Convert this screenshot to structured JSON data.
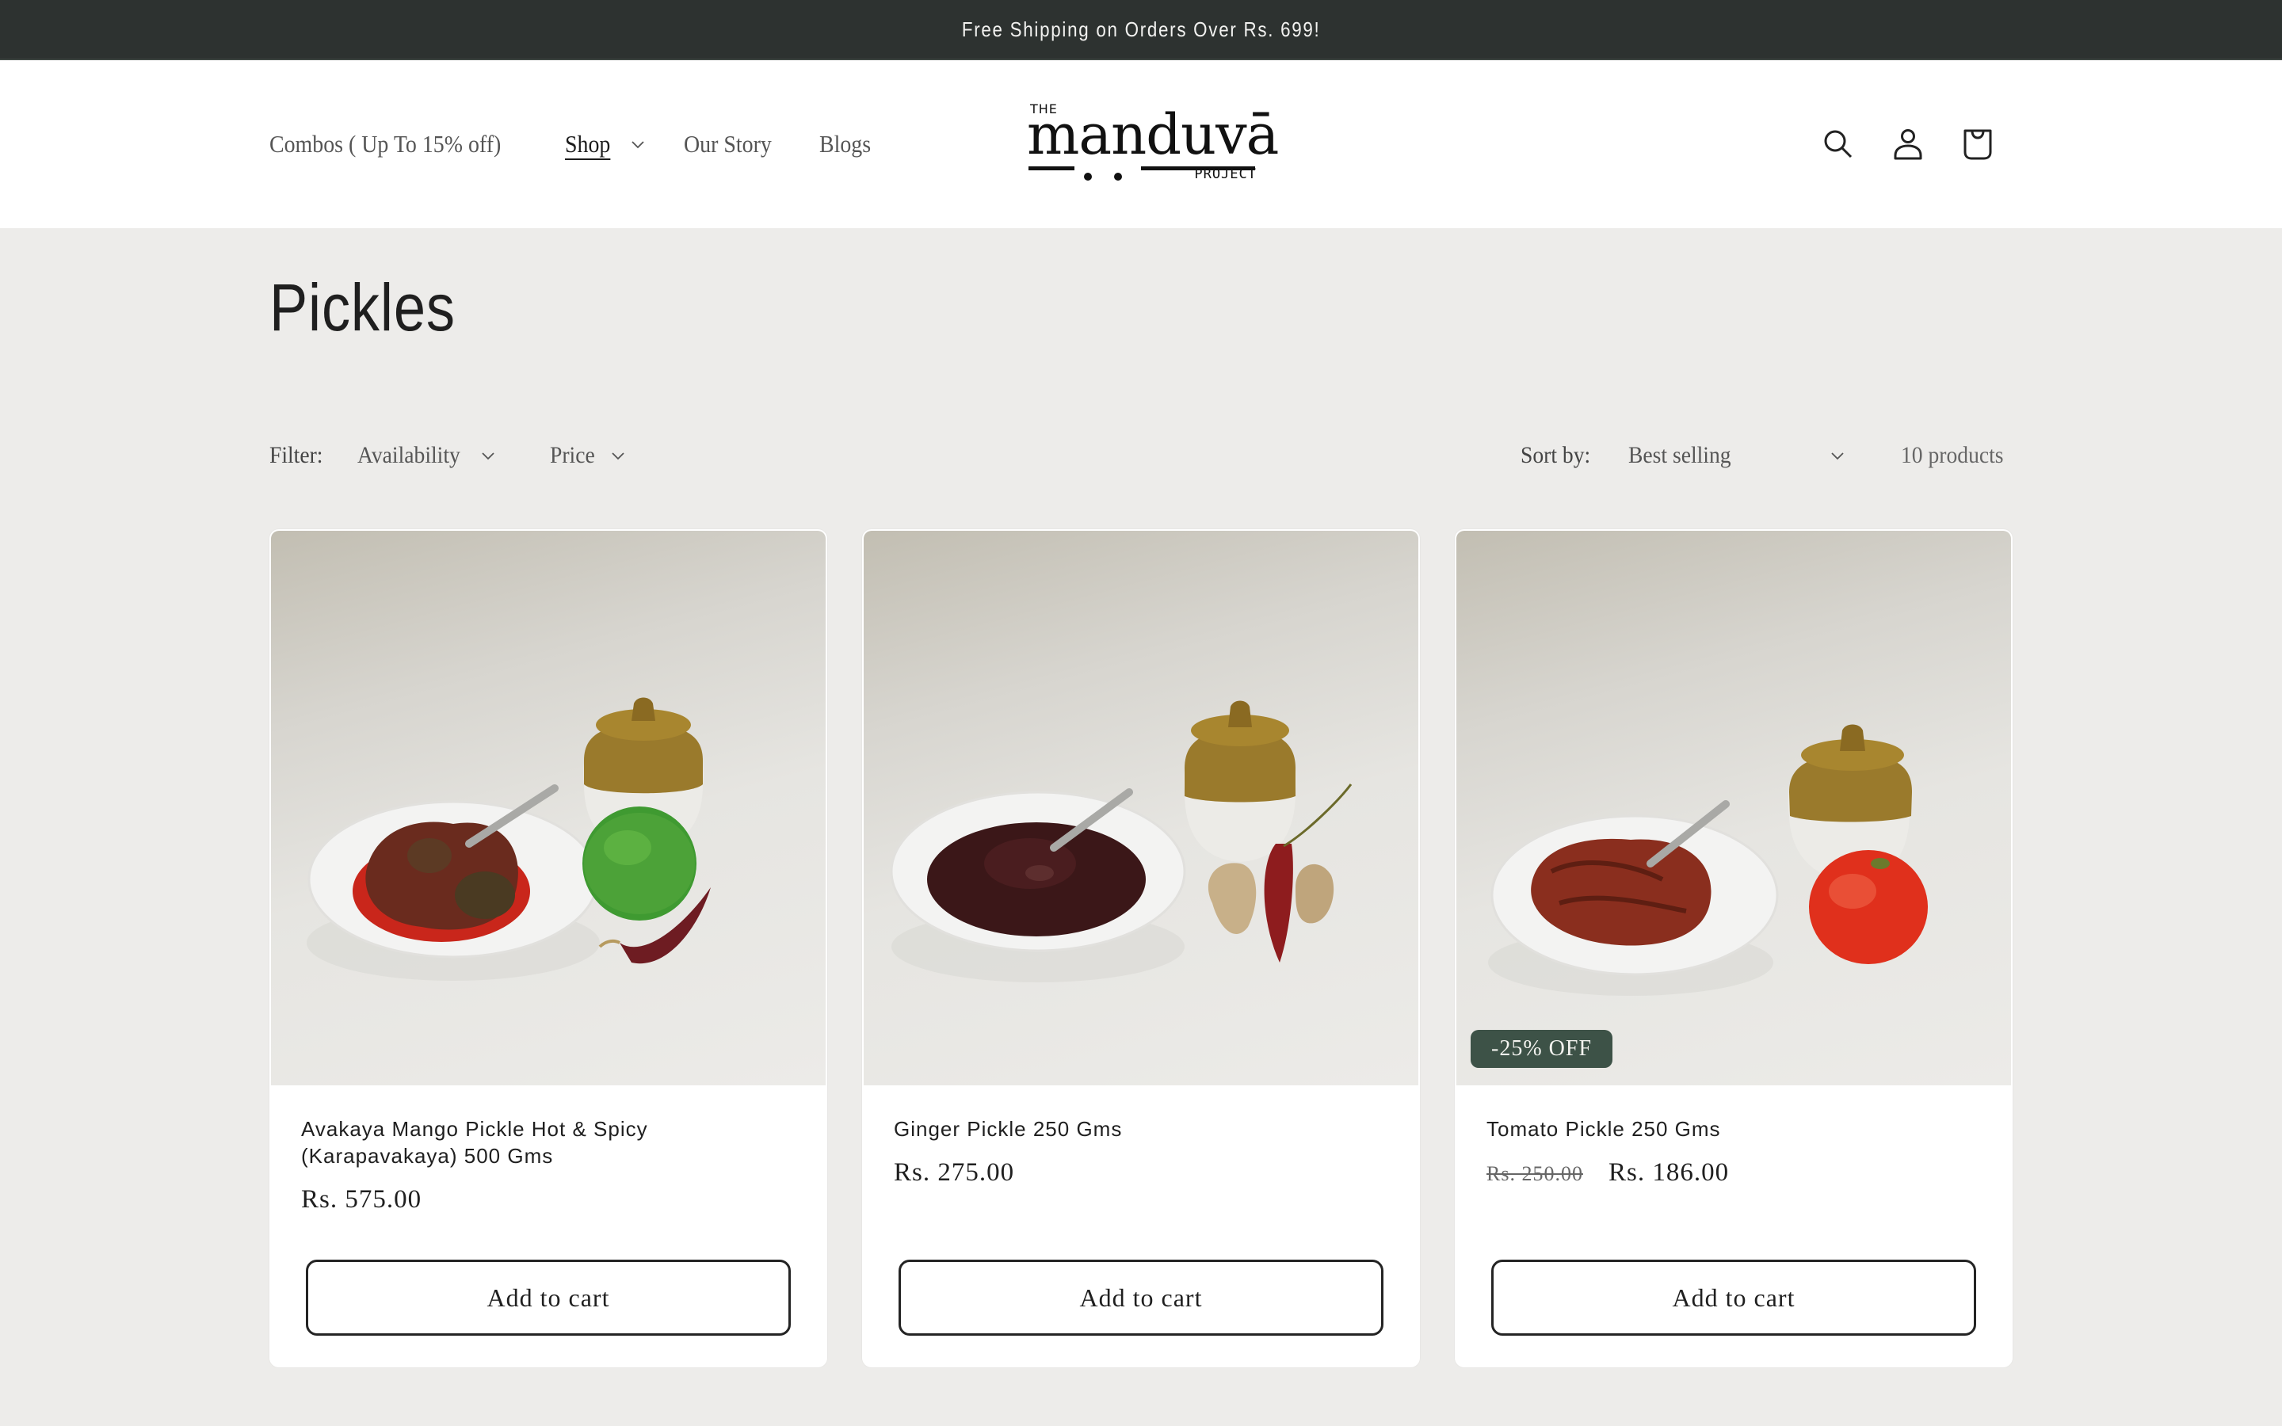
{
  "announcement": "Free Shipping on Orders Over Rs. 699!",
  "header": {
    "nav": [
      {
        "label": "Combos ( Up To 15% off)",
        "has_dropdown": false,
        "active": false
      },
      {
        "label": "Shop",
        "has_dropdown": true,
        "active": true
      },
      {
        "label": "Our Story",
        "has_dropdown": false,
        "active": false
      },
      {
        "label": "Blogs",
        "has_dropdown": false,
        "active": false
      }
    ],
    "logo": {
      "top": "THE",
      "word": "manduvā",
      "bottom": "PROJECT"
    },
    "icons": [
      "search-icon",
      "account-icon",
      "cart-icon"
    ]
  },
  "collection": {
    "title": "Pickles",
    "filter_label": "Filter:",
    "filters": [
      "Availability",
      "Price"
    ],
    "sort_label": "Sort by:",
    "sort_value": "Best selling",
    "product_count": "10 products"
  },
  "products": [
    {
      "name": "Avakaya Mango Pickle Hot & Spicy (Karapavakaya) 500 Gms",
      "price": "Rs. 575.00",
      "compare_price": null,
      "badge": null,
      "button": "Add to cart",
      "image": "mango-pickle-bowl-with-jar-mango-chili"
    },
    {
      "name": "Ginger Pickle 250 Gms",
      "price": "Rs. 275.00",
      "compare_price": null,
      "badge": null,
      "button": "Add to cart",
      "image": "ginger-pickle-bowl-with-jar-ginger-chili"
    },
    {
      "name": "Tomato Pickle 250 Gms",
      "price": "Rs. 186.00",
      "compare_price": "Rs. 250.00",
      "badge": "-25% OFF",
      "button": "Add to cart",
      "image": "tomato-pickle-bowl-with-jar-tomato"
    }
  ],
  "colors": {
    "announcement_bg": "#2d3230",
    "page_bg": "#edecea",
    "badge_bg": "#3d5247",
    "text": "#1f1f1f"
  }
}
